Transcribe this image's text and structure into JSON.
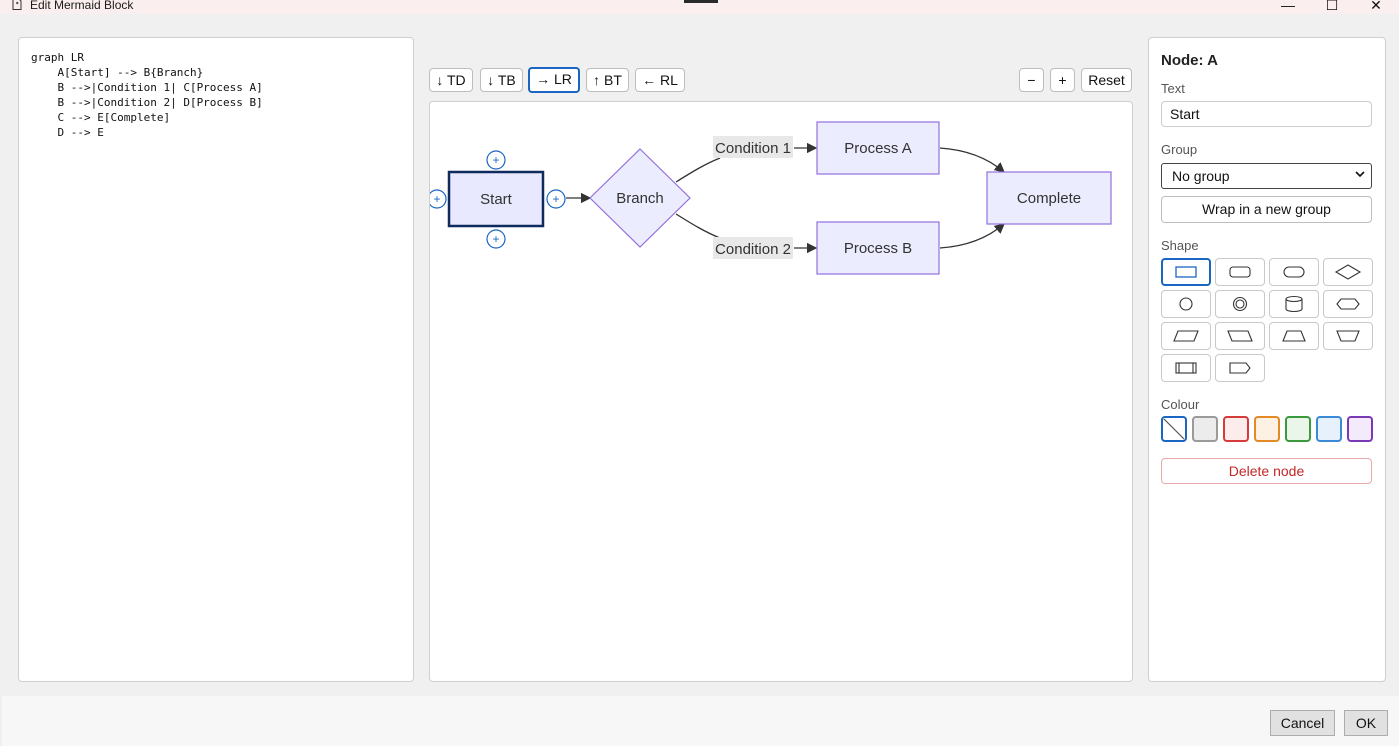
{
  "window": {
    "title": "Edit Mermaid Block",
    "minimize": "—",
    "maximize": "☐",
    "close": "✕"
  },
  "code": "graph LR\n    A[Start] --> B{Branch}\n    B -->|Condition 1| C[Process A]\n    B -->|Condition 2| D[Process B]\n    C --> E[Complete]\n    D --> E",
  "toolbar": {
    "directions": [
      {
        "label": "↓ TD",
        "active": false
      },
      {
        "label": "↓ TB",
        "active": false
      },
      {
        "label": "→ LR",
        "active": true
      },
      {
        "label": "↑ BT",
        "active": false
      },
      {
        "label": "← RL",
        "active": false
      }
    ],
    "zoom_out": "−",
    "zoom_in": "+",
    "reset": "Reset"
  },
  "diagram": {
    "nodes": {
      "start": "Start",
      "branch": "Branch",
      "process_a": "Process A",
      "process_b": "Process B",
      "complete": "Complete"
    },
    "edge_labels": {
      "condition1": "Condition 1",
      "condition2": "Condition 2"
    },
    "add_glyph": "+"
  },
  "inspector": {
    "heading": "Node: A",
    "text_label": "Text",
    "text_value": "Start",
    "group_label": "Group",
    "group_value": "No group",
    "wrap_button": "Wrap in a new group",
    "shape_label": "Shape",
    "shapes": [
      "rectangle",
      "rounded",
      "stadium",
      "diamond",
      "circle",
      "double-circle",
      "cylinder",
      "hexagon",
      "parallelogram",
      "parallelogram-alt",
      "trapezoid",
      "trapezoid-alt",
      "subroutine",
      "asymmetric"
    ],
    "selected_shape": "rectangle",
    "colour_label": "Colour",
    "colours": [
      {
        "name": "none",
        "fill": "#ffffff",
        "border": "#1a66c0"
      },
      {
        "name": "gray",
        "fill": "#ececec",
        "border": "#9a9a9a"
      },
      {
        "name": "red",
        "fill": "#fdecec",
        "border": "#d63a3a"
      },
      {
        "name": "orange",
        "fill": "#fdf1e4",
        "border": "#e38a27"
      },
      {
        "name": "green",
        "fill": "#eaf6ea",
        "border": "#3b9a3b"
      },
      {
        "name": "blue",
        "fill": "#e6f1fb",
        "border": "#3a8ad6"
      },
      {
        "name": "purple",
        "fill": "#f3ebfb",
        "border": "#7a3ab6"
      }
    ],
    "delete_button": "Delete node"
  },
  "footer": {
    "cancel": "Cancel",
    "ok": "OK"
  },
  "colors": {
    "accent": "#1a66c0",
    "node_fill": "#ececff",
    "node_stroke": "#9370db",
    "danger": "#c62828"
  }
}
